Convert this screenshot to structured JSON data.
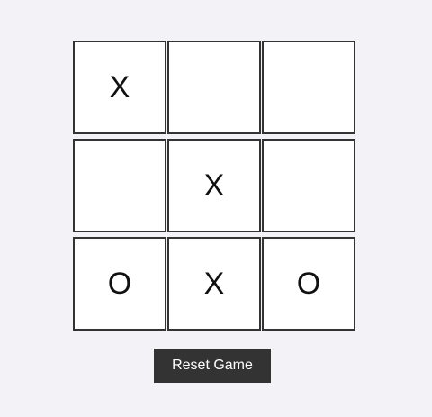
{
  "board": {
    "cells": [
      "X",
      "",
      "",
      "",
      "X",
      "",
      "O",
      "X",
      "O"
    ]
  },
  "controls": {
    "reset_label": "Reset Game"
  },
  "colors": {
    "background": "#f3f2f7",
    "cell_background": "#ffffff",
    "cell_border": "#333333",
    "button_background": "#333333",
    "button_text": "#ffffff"
  }
}
